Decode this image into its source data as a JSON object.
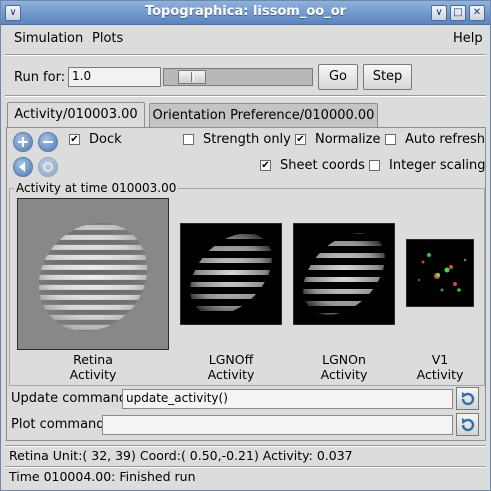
{
  "window": {
    "title": "Topographica: lissom_oo_or"
  },
  "menu": {
    "simulation": "Simulation",
    "plots": "Plots",
    "help": "Help"
  },
  "run": {
    "label": "Run for:",
    "value": "1.0",
    "go": "Go",
    "step": "Step",
    "slider_fraction": 0.1
  },
  "tabs": [
    {
      "label": "Activity/010003.00",
      "active": true
    },
    {
      "label": "Orientation Preference/010000.00",
      "active": false
    }
  ],
  "options": {
    "dock": {
      "label": "Dock",
      "checked": true
    },
    "strength_only": {
      "label": "Strength only",
      "checked": false
    },
    "normalize": {
      "label": "Normalize",
      "checked": true
    },
    "auto_refresh": {
      "label": "Auto refresh",
      "checked": false
    },
    "sheet_coords": {
      "label": "Sheet coords",
      "checked": true
    },
    "integer_scaling": {
      "label": "Integer scaling",
      "checked": false
    }
  },
  "plots": {
    "group_title": "Activity at time 010003.00",
    "items": [
      {
        "line1": "Retina",
        "line2": "Activity"
      },
      {
        "line1": "LGNOff",
        "line2": "Activity"
      },
      {
        "line1": "LGNOn",
        "line2": "Activity"
      },
      {
        "line1": "V1",
        "line2": "Activity"
      }
    ]
  },
  "commands": {
    "update_label": "Update command",
    "update_value": "update_activity()",
    "plot_label": "Plot command",
    "plot_value": ""
  },
  "status": {
    "unit_info": "Retina Unit:( 32, 39) Coord:( 0.50,-0.21) Activity:  0.037",
    "message": "Time 010004.00: Finished run"
  },
  "icons": {
    "window_menu": "chevron-down-icon",
    "minimize": "minimize-icon",
    "maximize": "maximize-icon",
    "close": "close-icon",
    "zoom_in": "zoom-in-icon",
    "zoom_out": "zoom-out-icon",
    "back": "back-icon",
    "forward": "forward-icon",
    "refresh": "refresh-icon"
  },
  "colors": {
    "titlebar": "#6f96c8",
    "accent": "#4a78b3"
  }
}
